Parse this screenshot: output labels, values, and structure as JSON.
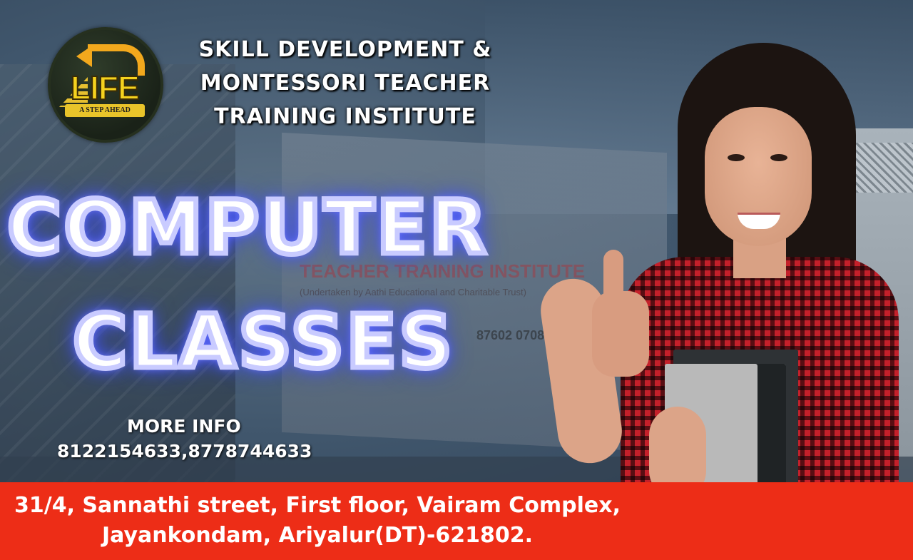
{
  "logo": {
    "word": "LIFE",
    "tagline": "A STEP AHEAD"
  },
  "institute": {
    "line1": "SKILL DEVELOPMENT &",
    "line2": "MONTESSORI TEACHER",
    "line3": "TRAINING INSTITUTE"
  },
  "headline": {
    "line1": "COMPUTER",
    "line2": "CLASSES"
  },
  "contact": {
    "label": "MORE INFO",
    "phones": "8122154633,8778744633"
  },
  "address": {
    "line1": "31/4, Sannathi street, First floor, Vairam Complex,",
    "line2": "Jayankondam, Ariyalur(DT)-621802."
  },
  "background_sign": {
    "line1": "TEACHER TRAINING INSTITUTE",
    "line2": "(Undertaken by Aathi Educational and Charitable Trust)",
    "line3": "87602 07083"
  },
  "colors": {
    "address_bar": "#ed2d17",
    "headline_glow": "#5160ff",
    "logo_accent": "#f2a81d"
  }
}
